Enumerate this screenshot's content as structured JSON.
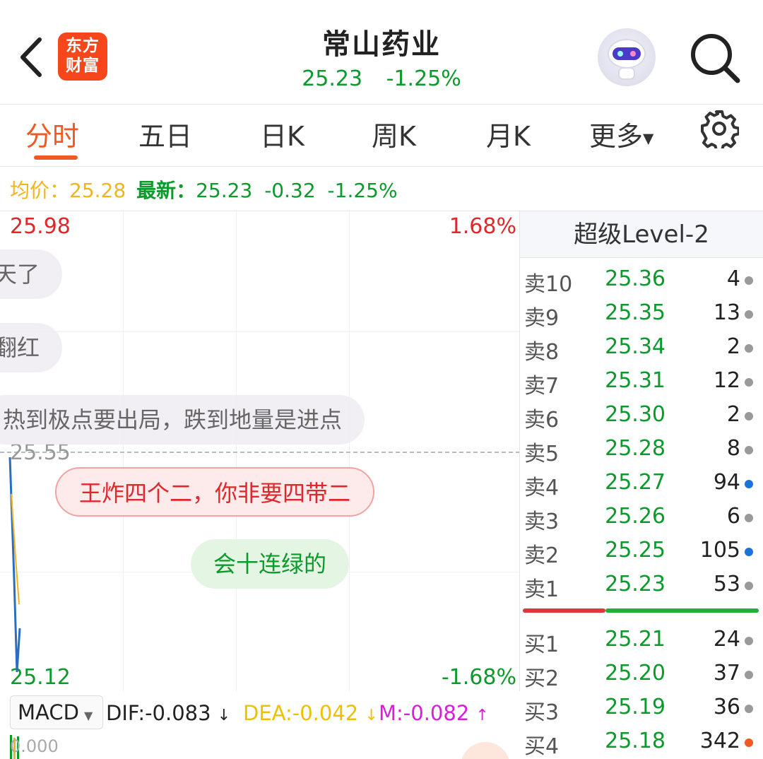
{
  "header": {
    "logo_line1": "东方",
    "logo_line2": "财富",
    "title": "常山药业",
    "price": "25.23",
    "change_pct": "-1.25%"
  },
  "tabs": [
    {
      "label": "分时",
      "active": true
    },
    {
      "label": "五日"
    },
    {
      "label": "日K"
    },
    {
      "label": "周K"
    },
    {
      "label": "月K"
    },
    {
      "label": "更多"
    }
  ],
  "info": {
    "avg_label": "均价：",
    "avg_value": "25.28",
    "latest_label": "最新：",
    "latest_value": "25.23",
    "change": "-0.32",
    "change_pct": "-1.25%"
  },
  "chart": {
    "high": "25.98",
    "high_pct": "1.68%",
    "low": "25.12",
    "low_pct": "-1.68%",
    "mid": "25.55"
  },
  "comments": [
    {
      "text": "天了",
      "style": "gray"
    },
    {
      "text": "翻红",
      "style": "gray"
    },
    {
      "text": "热到极点要出局，跌到地量是进点",
      "style": "gray"
    },
    {
      "text": "王炸四个二，你非要四带二",
      "style": "red"
    },
    {
      "text": "会十连绿的",
      "style": "green"
    }
  ],
  "macd": {
    "indicator": "MACD",
    "dif": "DIF:-0.083",
    "dea": "DEA:-0.042",
    "m": "M:-0.082",
    "zero": "0.000"
  },
  "order_book": {
    "title": "超级Level-2",
    "asks": [
      {
        "label": "卖10",
        "price": "25.36",
        "volume": "4",
        "dot": "gray"
      },
      {
        "label": "卖9",
        "price": "25.35",
        "volume": "13",
        "dot": "gray"
      },
      {
        "label": "卖8",
        "price": "25.34",
        "volume": "2",
        "dot": "gray"
      },
      {
        "label": "卖7",
        "price": "25.31",
        "volume": "12",
        "dot": "gray"
      },
      {
        "label": "卖6",
        "price": "25.30",
        "volume": "2",
        "dot": "gray"
      },
      {
        "label": "卖5",
        "price": "25.28",
        "volume": "8",
        "dot": "gray"
      },
      {
        "label": "卖4",
        "price": "25.27",
        "volume": "94",
        "dot": "blue"
      },
      {
        "label": "卖3",
        "price": "25.26",
        "volume": "6",
        "dot": "gray"
      },
      {
        "label": "卖2",
        "price": "25.25",
        "volume": "105",
        "dot": "blue"
      },
      {
        "label": "卖1",
        "price": "25.23",
        "volume": "53",
        "dot": "gray"
      }
    ],
    "bids": [
      {
        "label": "买1",
        "price": "25.21",
        "volume": "24",
        "dot": "gray"
      },
      {
        "label": "买2",
        "price": "25.20",
        "volume": "37",
        "dot": "gray"
      },
      {
        "label": "买3",
        "price": "25.19",
        "volume": "36",
        "dot": "gray"
      },
      {
        "label": "买4",
        "price": "25.18",
        "volume": "342",
        "dot": "orange"
      }
    ],
    "buy_sell_ratio": 0.35
  },
  "colors": {
    "accent": "#f05a22",
    "up": "#e0272c",
    "down": "#0b9a2b",
    "avg": "#f0b41e",
    "dot_gray": "#999999",
    "dot_blue": "#1a73d9",
    "dot_orange": "#f05a22"
  }
}
